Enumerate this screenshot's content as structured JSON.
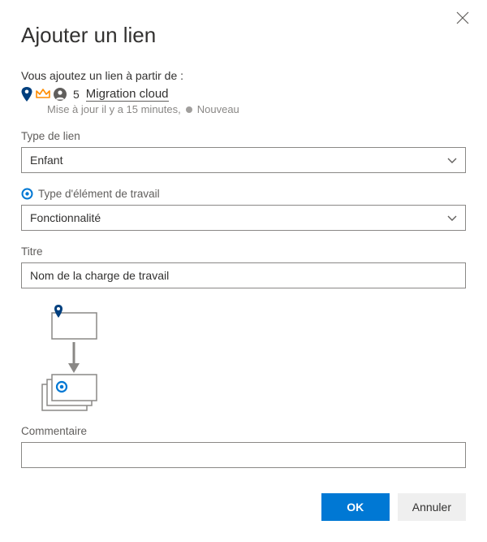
{
  "dialog": {
    "title": "Ajouter un lien",
    "intro": "Vous ajoutez un lien à partir de :",
    "source": {
      "id": "5",
      "name": "Migration cloud",
      "updated": "Mise à jour il y a 15 minutes,",
      "status": "Nouveau"
    }
  },
  "fields": {
    "link_type": {
      "label": "Type de lien",
      "value": "Enfant"
    },
    "work_item_type": {
      "label": "Type d'élément de travail",
      "value": "Fonctionnalité"
    },
    "title": {
      "label": "Titre",
      "value": "Nom de la charge de travail"
    },
    "comment": {
      "label": "Commentaire",
      "value": ""
    }
  },
  "buttons": {
    "ok": "OK",
    "cancel": "Annuler"
  },
  "icons": {
    "pin": "pin-icon",
    "crown": "crown-icon",
    "avatar": "avatar-icon",
    "target": "target-icon",
    "chevron": "chevron-down-icon",
    "close": "close-icon"
  },
  "colors": {
    "primary": "#0078d4",
    "pin_blue": "#003f7e",
    "crown_orange": "#ff8c00",
    "avatar_gray": "#605e5c",
    "border_gray": "#8a8886"
  }
}
